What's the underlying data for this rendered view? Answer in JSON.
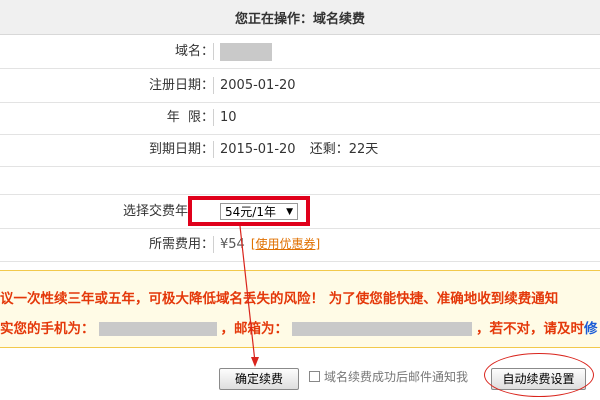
{
  "header": {
    "title": "您正在操作：域名续费"
  },
  "form": {
    "domain_label": "域名：",
    "reg_date_label": "注册日期：",
    "reg_date_value": "2005-01-20",
    "years_label": "年  限：",
    "years_value": "10",
    "expiry_label": "到期日期：",
    "expiry_value": "2015-01-20",
    "remaining_text": "还剩：22天",
    "select_label": "选择交费年头：",
    "select_value": "54元/1年",
    "select_arrow": "▼",
    "fee_label": "所需费用：",
    "fee_value": "¥54",
    "coupon_link": "[使用优惠券]"
  },
  "notice": {
    "line1": "议一次性续三年或五年，可极大降低域名丢失的风险！ 为了使您能快捷、准确地收到续费通知",
    "line2_a": "实您的手机为：",
    "line2_b": "，邮箱为：",
    "line2_c": "，若不对，请及时",
    "line2_link": "修"
  },
  "actions": {
    "confirm_button": "确定续费",
    "email_notify_label": "域名续费成功后邮件通知我",
    "email_notify_checked": false,
    "auto_renew_button": "自动续费设置"
  },
  "colors": {
    "highlight_box": "#e0001b",
    "notice_text": "#e4380a",
    "coupon_link": "#e07000",
    "annotation": "#d9241c"
  }
}
